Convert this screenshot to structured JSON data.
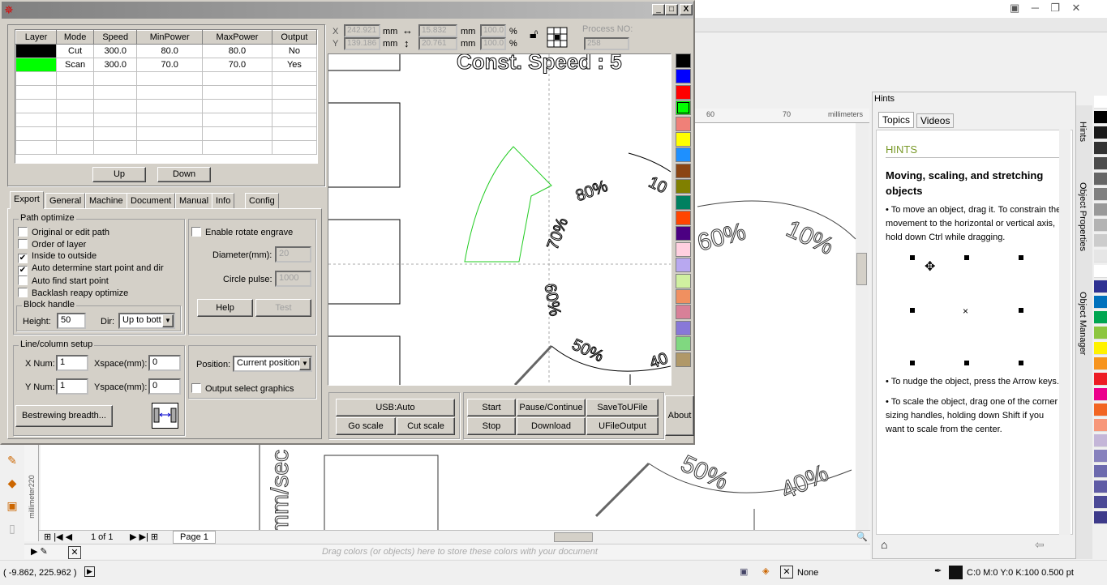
{
  "corel": {
    "ruler_ticks": [
      "60",
      "70"
    ],
    "ruler_unit": "millimeters",
    "vertical_ruler_label": "millimeter220",
    "page_nav": {
      "counter": "1 of 1",
      "page_tab": "Page 1"
    },
    "color_tray_hint": "Drag colors (or objects) here to store these colors with your document",
    "status": {
      "coords": "( -9.862, 225.962 )",
      "fill": "None",
      "outline": "C:0 M:0 Y:0 K:100  0.500 pt"
    },
    "canvas_texts": {
      "t60": "60%",
      "t10": "10%",
      "t50": "50%",
      "t40": "40%",
      "unit": "mm/sec"
    },
    "side_tabs": [
      "Hints",
      "Object Properties",
      "Object Manager"
    ],
    "palette": [
      "#ffffff",
      "#000000",
      "#1a1a1a",
      "#333333",
      "#4d4d4d",
      "#666666",
      "#808080",
      "#999999",
      "#b3b3b3",
      "#cccccc",
      "#e6e6e6",
      "#ffffff",
      "#2e3192",
      "#0071bc",
      "#00a651",
      "#8dc63f",
      "#fff200",
      "#f7941d",
      "#ed1c24",
      "#ec008c",
      "#f26522",
      "#f7977a",
      "#c4b6d8",
      "#8781bd",
      "#6d6aae",
      "#5f5ba5",
      "#4b4996",
      "#3d3a8a"
    ]
  },
  "hints": {
    "title": "Hints",
    "tabs": [
      "Topics",
      "Videos"
    ],
    "heading": "HINTS",
    "topic": "Moving, scaling, and stretching objects",
    "p1": "• To move an object, drag it. To constrain the movement to the horizontal or vertical axis, hold down Ctrl while dragging.",
    "p2": "• To nudge the object, press the Arrow keys.",
    "p3": "• To scale the object, drag one of the corner sizing handles, holding down Shift if you want to scale from the center."
  },
  "laser": {
    "window_buttons": [
      "_",
      "□",
      "X"
    ],
    "layers": {
      "headers": [
        "Layer",
        "Mode",
        "Speed",
        "MinPower",
        "MaxPower",
        "Output"
      ],
      "rows": [
        {
          "color": "#000000",
          "mode": "Cut",
          "speed": "300.0",
          "min": "80.0",
          "max": "80.0",
          "output": "No"
        },
        {
          "color": "#00ff00",
          "mode": "Scan",
          "speed": "300.0",
          "min": "70.0",
          "max": "70.0",
          "output": "Yes"
        }
      ]
    },
    "up": "Up",
    "down": "Down",
    "coords": {
      "x_label": "X",
      "y_label": "Y",
      "x": "242.921",
      "y": "139.186",
      "w": "15.832",
      "h": "20.761",
      "unit": "mm",
      "sx": "100.0",
      "sy": "100.0",
      "pct": "%",
      "process_label": "Process NO:",
      "process": "258"
    },
    "tabs": [
      "Export",
      "General",
      "Machine",
      "Document",
      "Manual",
      "Info",
      "Config"
    ],
    "path_optimize": {
      "title": "Path optimize",
      "options": [
        {
          "label": "Original or edit path",
          "checked": false
        },
        {
          "label": "Order of layer",
          "checked": false
        },
        {
          "label": "Inside to outside",
          "checked": true
        },
        {
          "label": "Auto determine start point and dir",
          "checked": true
        },
        {
          "label": "Auto find start point",
          "checked": false
        },
        {
          "label": "Backlash reapy optimize",
          "checked": false
        }
      ]
    },
    "block": {
      "title": "Block handle",
      "height_label": "Height:",
      "height": "50",
      "dir_label": "Dir:",
      "dir": "Up to bott"
    },
    "rotate": {
      "enable": "Enable rotate engrave",
      "diameter_label": "Diameter(mm):",
      "diameter": "20",
      "pulse_label": "Circle pulse:",
      "pulse": "1000",
      "help": "Help",
      "test": "Test"
    },
    "line": {
      "title": "Line/column setup",
      "xnum_label": "X Num:",
      "xnum": "1",
      "xspace_label": "Xspace(mm):",
      "xspace": "0",
      "ynum_label": "Y Num:",
      "ynum": "1",
      "yspace_label": "Yspace(mm):",
      "yspace": "0",
      "bestrew": "Bestrewing breadth..."
    },
    "position": {
      "label": "Position:",
      "value": "Current position",
      "output_select": "Output select graphics"
    },
    "preview": {
      "title_text": "Const. Speed : 5",
      "p80": "80%",
      "p10": "10",
      "p70": "70%",
      "p60": "60%",
      "p50": "50%",
      "p40": "40"
    },
    "swatches": [
      "#000000",
      "#0000ff",
      "#ff0000",
      "#00ff00",
      "#f08078",
      "#ffff00",
      "#1e90ff",
      "#8b4513",
      "#808000",
      "#008060",
      "#ff4500",
      "#4b0082",
      "#ffd0e0",
      "#b8a8f0",
      "#d0f0a0",
      "#f09060",
      "#d88098",
      "#8878d8",
      "#80d880",
      "#b09868"
    ],
    "buttons": {
      "usb": "USB:Auto",
      "go_scale": "Go scale",
      "cut_scale": "Cut scale",
      "start": "Start",
      "pause": "Pause/Continue",
      "save_u": "SaveToUFile",
      "stop": "Stop",
      "download": "Download",
      "u_output": "UFileOutput",
      "about": "About"
    }
  }
}
